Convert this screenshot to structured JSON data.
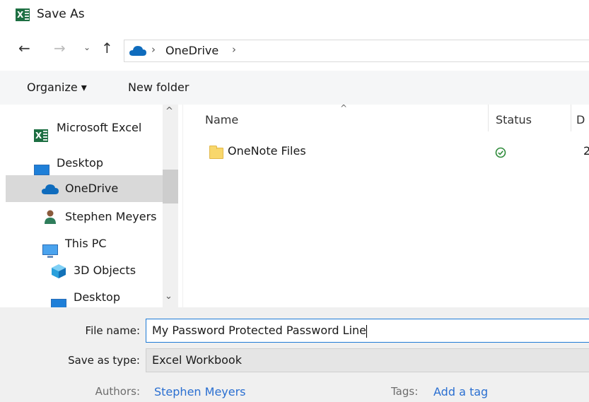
{
  "window": {
    "title": "Save As"
  },
  "address": {
    "crumbs": [
      "OneDrive"
    ]
  },
  "toolbar": {
    "organize": "Organize ▾",
    "new_folder": "New folder"
  },
  "nav": {
    "items": [
      {
        "label": "Microsoft Excel",
        "icon": "excel-icon"
      },
      {
        "label": "Desktop",
        "icon": "desktop-icon"
      },
      {
        "label": "OneDrive",
        "icon": "onedrive-icon",
        "selected": true
      },
      {
        "label": "Stephen Meyers",
        "icon": "user-icon"
      },
      {
        "label": "This PC",
        "icon": "pc-icon"
      },
      {
        "label": "3D Objects",
        "icon": "3d-objects-icon"
      },
      {
        "label": "Desktop",
        "icon": "desktop-icon"
      }
    ]
  },
  "files": {
    "columns": [
      "Name",
      "Status",
      "D"
    ],
    "rows": [
      {
        "name": "OneNote Files",
        "status": "synced",
        "date": "2"
      }
    ]
  },
  "form": {
    "file_name_label": "File name:",
    "file_name_value": "My Password Protected Password Line",
    "save_type_label": "Save as type:",
    "save_type_value": "Excel Workbook",
    "authors_label": "Authors:",
    "authors_value": "Stephen Meyers",
    "tags_label": "Tags:",
    "tags_value": "Add a tag"
  },
  "colors": {
    "excel": "#1d6f42",
    "onedrive": "#0f6cbd",
    "link": "#2a6fd1",
    "selected": "#d9d9d9"
  }
}
